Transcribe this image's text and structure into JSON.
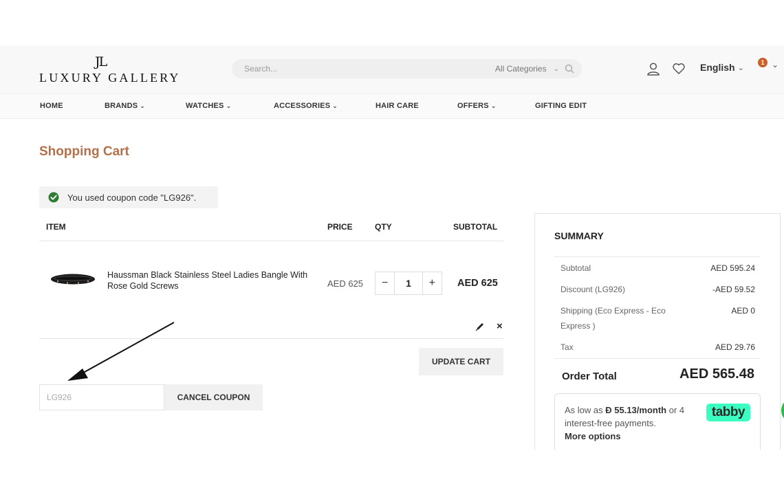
{
  "header": {
    "logo_mark": "JL",
    "logo_text": "LUXURY GALLERY",
    "search_placeholder": "Search...",
    "category_select": "All Categories",
    "language": "English",
    "cart_count": "1"
  },
  "nav": {
    "items": [
      {
        "label": "HOME",
        "has_dropdown": false
      },
      {
        "label": "BRANDS",
        "has_dropdown": true
      },
      {
        "label": "WATCHES",
        "has_dropdown": true
      },
      {
        "label": "ACCESSORIES",
        "has_dropdown": true
      },
      {
        "label": "HAIR CARE",
        "has_dropdown": false
      },
      {
        "label": "OFFERS",
        "has_dropdown": true
      },
      {
        "label": "GIFTING EDIT",
        "has_dropdown": false
      }
    ]
  },
  "page": {
    "title": "Shopping Cart",
    "coupon_message": "You used coupon code \"LG926\"."
  },
  "cart": {
    "headers": {
      "item": "ITEM",
      "price": "PRICE",
      "qty": "QTY",
      "subtotal": "SUBTOTAL"
    },
    "items": [
      {
        "name": "Haussman Black Stainless Steel Ladies Bangle With Rose Gold Screws",
        "price": "AED 625",
        "qty": "1",
        "subtotal": "AED 625"
      }
    ],
    "qty_minus": "−",
    "qty_plus": "+",
    "remove_symbol": "×",
    "update_label": "UPDATE CART",
    "coupon_value": "LG926",
    "cancel_coupon_label": "CANCEL COUPON"
  },
  "summary": {
    "title": "SUMMARY",
    "rows": [
      {
        "label": "Subtotal",
        "value": "AED 595.24"
      },
      {
        "label": "Discount (LG926)",
        "value": "-AED 59.52"
      },
      {
        "label": "Shipping (Eco Express - Eco Express )",
        "value": "AED 0"
      },
      {
        "label": "Tax",
        "value": "AED 29.76"
      }
    ],
    "order_total_label": "Order Total",
    "order_total_value": "AED 565.48",
    "tabby": {
      "text_prefix": "As low as ",
      "amount": "Ð 55.13/month",
      "text_suffix": " or 4 interest-free payments.",
      "more": "More options",
      "logo": "tabby"
    }
  },
  "colors": {
    "accent": "#b5704a",
    "badge": "#c8612a",
    "success": "#2e7d32",
    "tabby": "#3bffc1",
    "chat": "#2fb84a"
  }
}
